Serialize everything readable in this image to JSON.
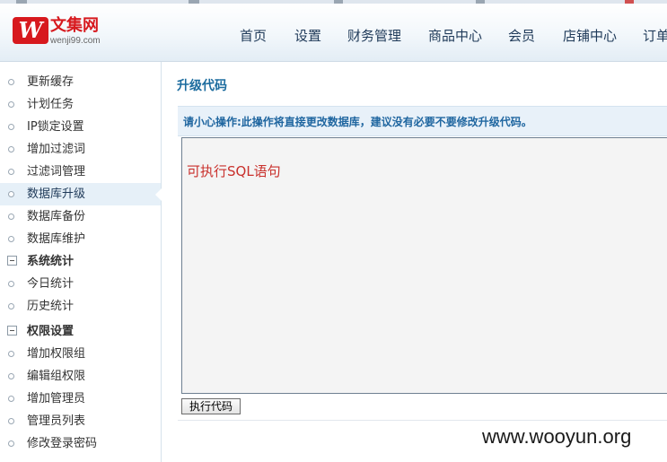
{
  "logo": {
    "mark": "W",
    "name_cn": "文集网",
    "domain": "wenji99.com"
  },
  "nav": {
    "items": [
      "首页",
      "设置",
      "财务管理",
      "商品中心",
      "会员",
      "店铺中心",
      "订单"
    ]
  },
  "sidebar": {
    "items": [
      {
        "label": "更新缓存",
        "type": "item"
      },
      {
        "label": "计划任务",
        "type": "item"
      },
      {
        "label": "IP锁定设置",
        "type": "item"
      },
      {
        "label": "增加过滤词",
        "type": "item"
      },
      {
        "label": "过滤词管理",
        "type": "item"
      },
      {
        "label": "数据库升级",
        "type": "item",
        "active": true
      },
      {
        "label": "数据库备份",
        "type": "item"
      },
      {
        "label": "数据库维护",
        "type": "item"
      },
      {
        "label": "系统统计",
        "type": "group"
      },
      {
        "label": "今日统计",
        "type": "item"
      },
      {
        "label": "历史统计",
        "type": "item"
      },
      {
        "label": "权限设置",
        "type": "group"
      },
      {
        "label": "增加权限组",
        "type": "item"
      },
      {
        "label": "编辑组权限",
        "type": "item"
      },
      {
        "label": "增加管理员",
        "type": "item"
      },
      {
        "label": "管理员列表",
        "type": "item"
      },
      {
        "label": "修改登录密码",
        "type": "item"
      }
    ]
  },
  "main": {
    "title": "升级代码",
    "notice": "请小心操作:此操作将直接更改数据库，建议没有必要不要修改升级代码。",
    "code_text": "可执行SQL语句",
    "exec_button": "执行代码"
  },
  "watermark": "www.wooyun.org",
  "colors": {
    "brand_red": "#d7191e",
    "accent_blue": "#1b6b9e",
    "code_red": "#c9302c"
  }
}
